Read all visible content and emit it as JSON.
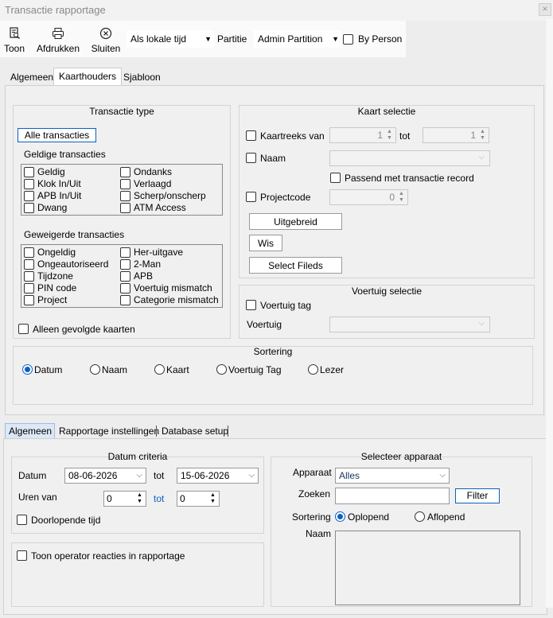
{
  "window": {
    "title": "Transactie rapportage",
    "close": "×"
  },
  "toolbar": {
    "toon": "Toon",
    "afdrukken": "Afdrukken",
    "sluiten": "Sluiten",
    "time_mode": "Als lokale tijd",
    "partitie_label": "Partitie",
    "partition": "Admin Partition",
    "by_person": "By Person"
  },
  "top_tabs": [
    "Algemeen",
    "Kaarthouders",
    "Sjabloon"
  ],
  "transactie_type": {
    "title": "Transactie type",
    "alle_button": "Alle transacties",
    "geldig_title": "Geldige transacties",
    "geldig_left": [
      "Geldig",
      "Klok In/Uit",
      "APB In/Uit",
      "Dwang"
    ],
    "geldig_right": [
      "Ondanks",
      "Verlaagd",
      "Scherp/onscherp",
      "ATM Access"
    ],
    "geweigerd_title": "Geweigerde transacties",
    "geweigerd_left": [
      "Ongeldig",
      "Ongeautoriseerd",
      "Tijdzone",
      "PIN code",
      "Project"
    ],
    "geweigerd_right": [
      "Her-uitgave",
      "2-Man",
      "APB",
      "Voertuig mismatch",
      "Categorie mismatch"
    ],
    "alleen": "Alleen gevolgde kaarten"
  },
  "kaart_selectie": {
    "title": "Kaart selectie",
    "kaartreeks": "Kaartreeks van",
    "from": "1",
    "tot": "tot",
    "to": "1",
    "naam": "Naam",
    "passend": "Passend met transactie record",
    "projectcode": "Projectcode",
    "project_val": "0",
    "uitgebreid": "Uitgebreid",
    "wis": "Wis",
    "select_fileds": "Select Fileds"
  },
  "voertuig_selectie": {
    "title": "Voertuig selectie",
    "tag": "Voertuig tag",
    "voertuig": "Voertuig"
  },
  "sortering_top": {
    "title": "Sortering",
    "options": [
      "Datum",
      "Naam",
      "Kaart",
      "Voertuig Tag",
      "Lezer"
    ],
    "selected": "Datum"
  },
  "bottom_tabs": [
    "Algemeen",
    "Rapportage instellingen",
    "Database setup"
  ],
  "datum_criteria": {
    "title": "Datum criteria",
    "datum": "Datum",
    "from_date": "08-06-2026",
    "tot": "tot",
    "to_date": "15-06-2026",
    "uren_van": "Uren van",
    "uren_from": "0",
    "uren_tot": "tot",
    "uren_to": "0",
    "doorlopende": "Doorlopende tijd"
  },
  "toon_operator": "Toon operator reacties in rapportage",
  "selecteer_apparaat": {
    "title": "Selecteer apparaat",
    "apparaat": "Apparaat",
    "apparaat_value": "Alles",
    "zoeken": "Zoeken",
    "filter": "Filter",
    "sortering": "Sortering",
    "oplopend": "Oplopend",
    "aflopend": "Aflopend",
    "naam": "Naam"
  }
}
